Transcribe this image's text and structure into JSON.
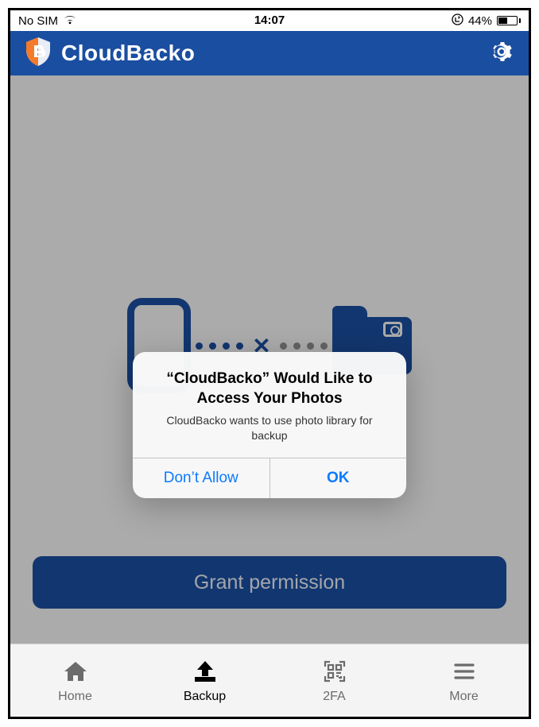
{
  "statusbar": {
    "carrier": "No SIM",
    "time": "14:07",
    "battery_percent": "44%"
  },
  "header": {
    "title": "CloudBacko"
  },
  "main": {
    "grant_button_label": "Grant permission"
  },
  "alert": {
    "title": "“CloudBacko” Would Like to Access Your Photos",
    "message": "CloudBacko wants to use photo library for backup",
    "dont_allow_label": "Don’t Allow",
    "ok_label": "OK"
  },
  "tabs": {
    "home": "Home",
    "backup": "Backup",
    "twofa": "2FA",
    "more": "More"
  },
  "colors": {
    "brand": "#1a4ea0",
    "ios_link": "#0a7aff"
  }
}
